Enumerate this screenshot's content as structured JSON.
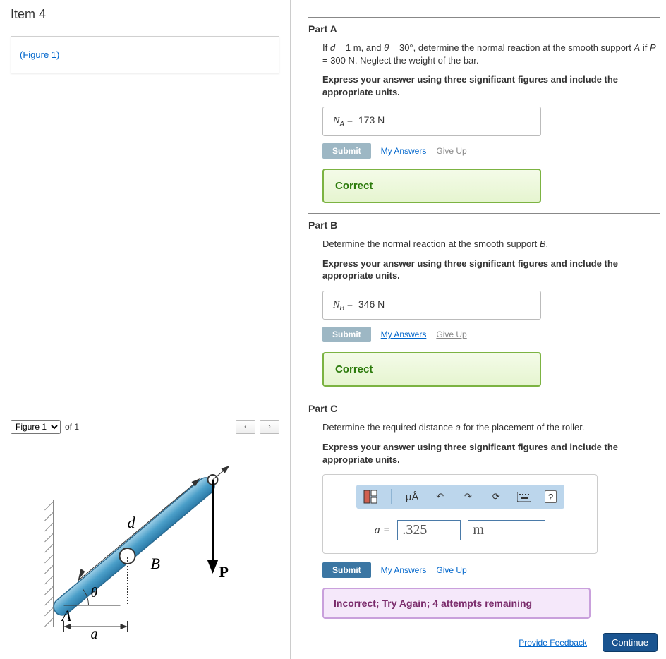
{
  "item_title": "Item 4",
  "figure_link": "(Figure 1)",
  "figure_nav": {
    "selected": "Figure 1",
    "of_label": "of 1"
  },
  "parts": {
    "a": {
      "title": "Part A",
      "prompt_html": "If <i>d</i> = 1 m, and <i>θ</i> = 30°, determine the normal reaction at the smooth support <i>A</i> if <i>P</i> = 300 N. Neglect the weight of the bar.",
      "instruction": "Express your answer using three significant figures and include the appropriate units.",
      "answer_var": "N",
      "answer_sub": "A",
      "answer_value": "173 N",
      "submit": "Submit",
      "my_answers": "My Answers",
      "give_up": "Give Up",
      "feedback": "Correct"
    },
    "b": {
      "title": "Part B",
      "prompt": "Determine the normal reaction at the smooth support B.",
      "instruction": "Express your answer using three significant figures and include the appropriate units.",
      "answer_var": "N",
      "answer_sub": "B",
      "answer_value": "346 N",
      "submit": "Submit",
      "my_answers": "My Answers",
      "give_up": "Give Up",
      "feedback": "Correct"
    },
    "c": {
      "title": "Part C",
      "prompt": "Determine the required distance a for the placement of the roller.",
      "instruction": "Express your answer using three significant figures and include the appropriate units.",
      "var_label": "a =",
      "value_input": ".325",
      "unit_input": "m",
      "toolbar": {
        "units": "μÅ",
        "help": "?"
      },
      "submit": "Submit",
      "my_answers": "My Answers",
      "give_up": "Give Up",
      "feedback": "Incorrect; Try Again; 4 attempts remaining"
    }
  },
  "footer": {
    "provide_feedback": "Provide Feedback",
    "continue": "Continue"
  },
  "figure_labels": {
    "d": "d",
    "B": "B",
    "P": "P",
    "theta": "θ",
    "A": "A",
    "a": "a"
  }
}
